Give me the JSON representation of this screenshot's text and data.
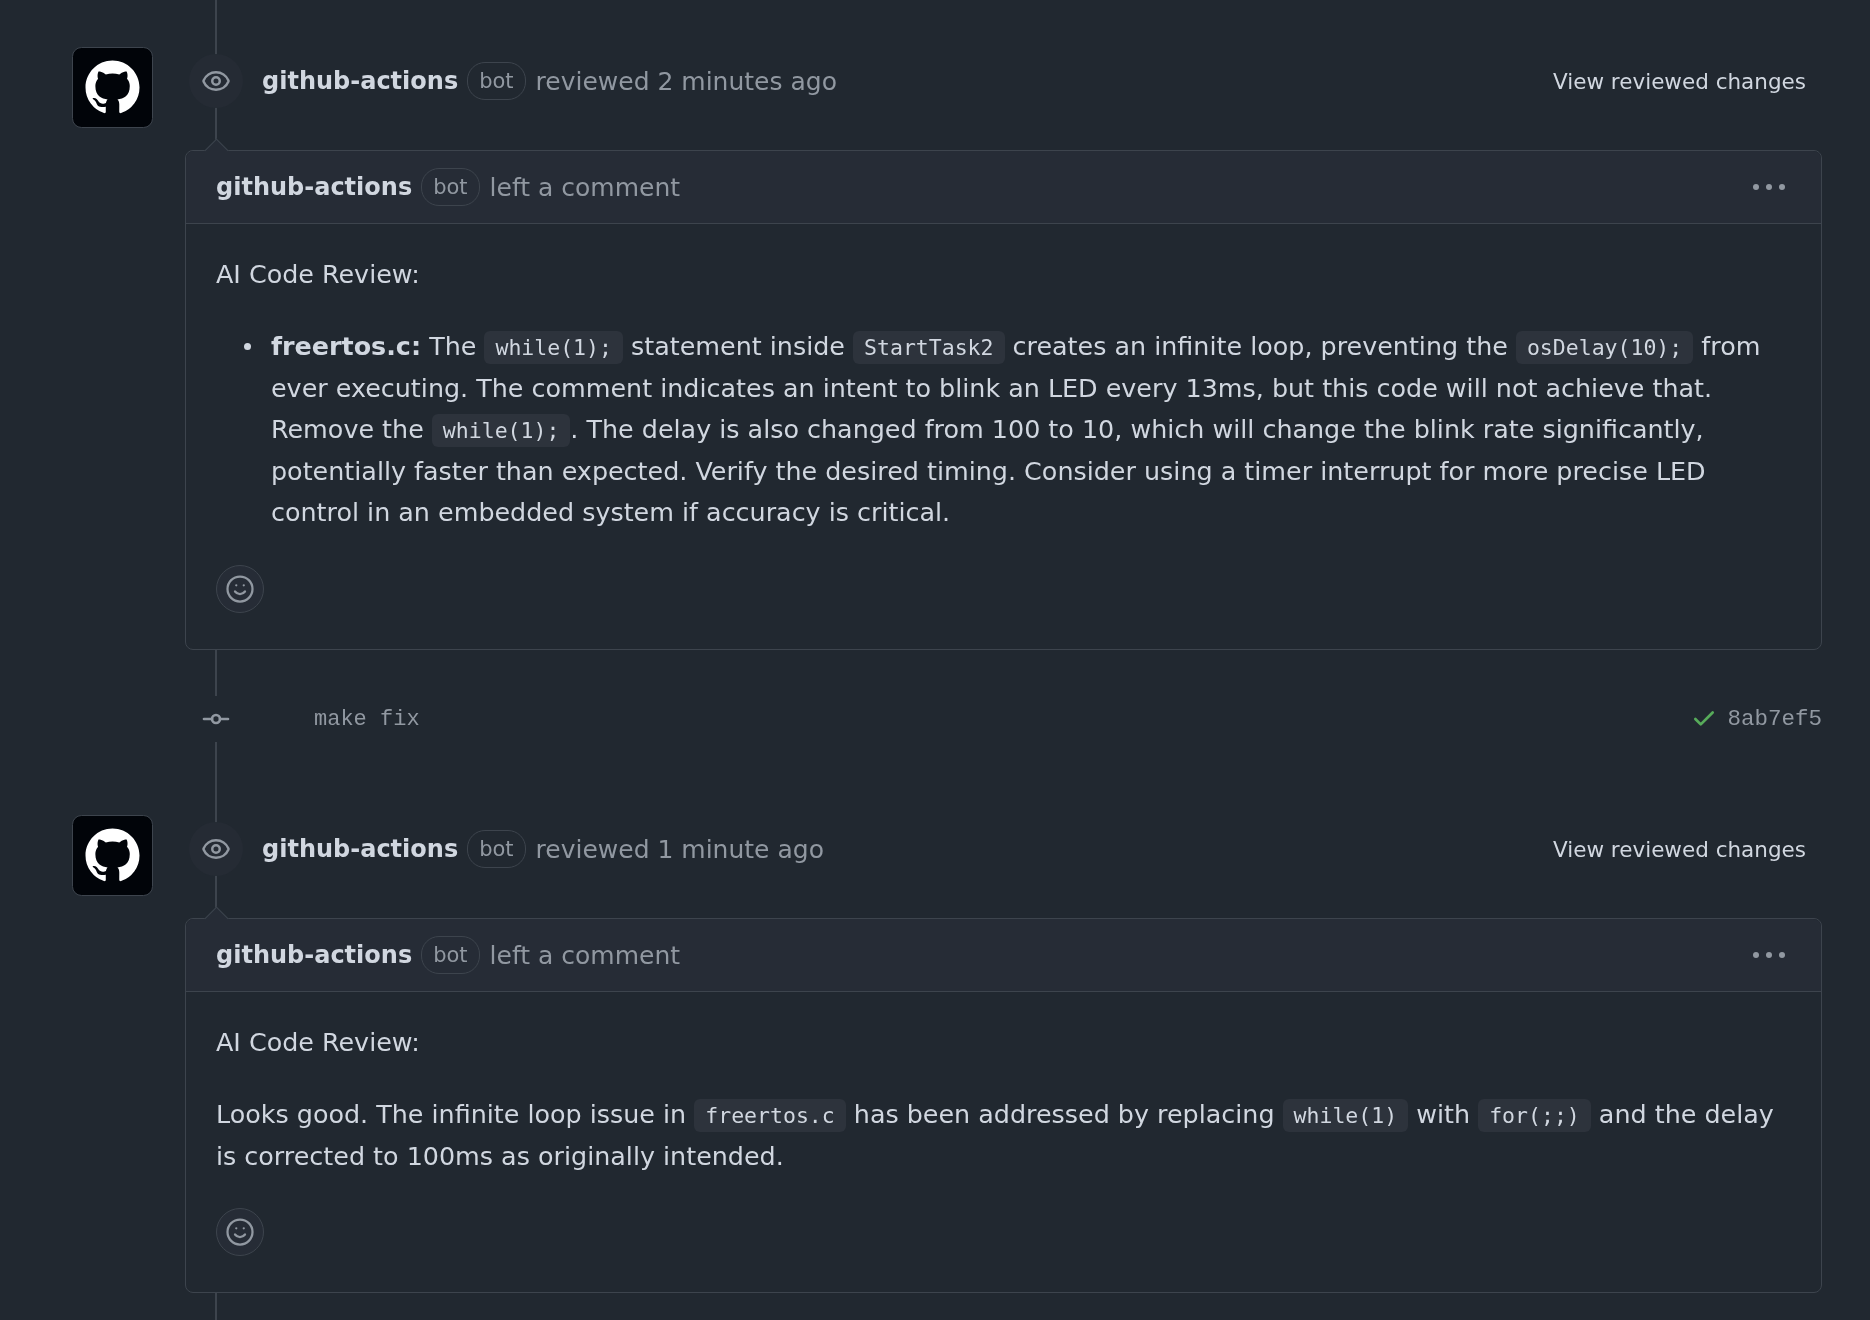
{
  "timeline": [
    {
      "kind": "review",
      "author": "github-actions",
      "badge": "bot",
      "action": "reviewed 2 minutes ago",
      "link": "View reviewed changes",
      "comment": {
        "author": "github-actions",
        "badge": "bot",
        "action": "left a comment",
        "blocks": [
          {
            "kind": "paragraph",
            "segments": [
              {
                "kind": "text",
                "text": "AI Code Review:"
              }
            ]
          },
          {
            "kind": "list",
            "items": [
              {
                "segments": [
                  {
                    "kind": "text",
                    "text": "**freertos.c:** The "
                  },
                  {
                    "kind": "code",
                    "text": "while(1);"
                  },
                  {
                    "kind": "text",
                    "text": " statement inside "
                  },
                  {
                    "kind": "code",
                    "text": "StartTask2"
                  },
                  {
                    "kind": "text",
                    "text": " creates an infinite loop, preventing the "
                  },
                  {
                    "kind": "code",
                    "text": "osDelay(10);"
                  },
                  {
                    "kind": "text",
                    "text": " from ever executing. The comment indicates an intent to blink an LED every 13ms, but this code will not achieve that. Remove the "
                  },
                  {
                    "kind": "code",
                    "text": "while(1);"
                  },
                  {
                    "kind": "text",
                    "text": ". The delay is also changed from 100 to 10, which will change the blink rate significantly, potentially faster than expected. Verify the desired timing. Consider using a timer interrupt for more precise LED control in an embedded system if accuracy is critical."
                  }
                ]
              }
            ]
          }
        ]
      }
    },
    {
      "kind": "commit",
      "message": "make fix",
      "checks_passed": true,
      "hash": "8ab7ef5"
    },
    {
      "kind": "review",
      "author": "github-actions",
      "badge": "bot",
      "action": "reviewed 1 minute ago",
      "link": "View reviewed changes",
      "comment": {
        "author": "github-actions",
        "badge": "bot",
        "action": "left a comment",
        "blocks": [
          {
            "kind": "paragraph",
            "segments": [
              {
                "kind": "text",
                "text": "AI Code Review:"
              }
            ]
          },
          {
            "kind": "paragraph",
            "segments": [
              {
                "kind": "text",
                "text": "Looks good. The infinite loop issue in "
              },
              {
                "kind": "code",
                "text": "freertos.c"
              },
              {
                "kind": "text",
                "text": " has been addressed by replacing "
              },
              {
                "kind": "code",
                "text": "while(1)"
              },
              {
                "kind": "text",
                "text": " with "
              },
              {
                "kind": "code",
                "text": "for(;;)"
              },
              {
                "kind": "text",
                "text": " and the delay is corrected to 100ms as originally intended."
              }
            ]
          }
        ]
      }
    }
  ]
}
